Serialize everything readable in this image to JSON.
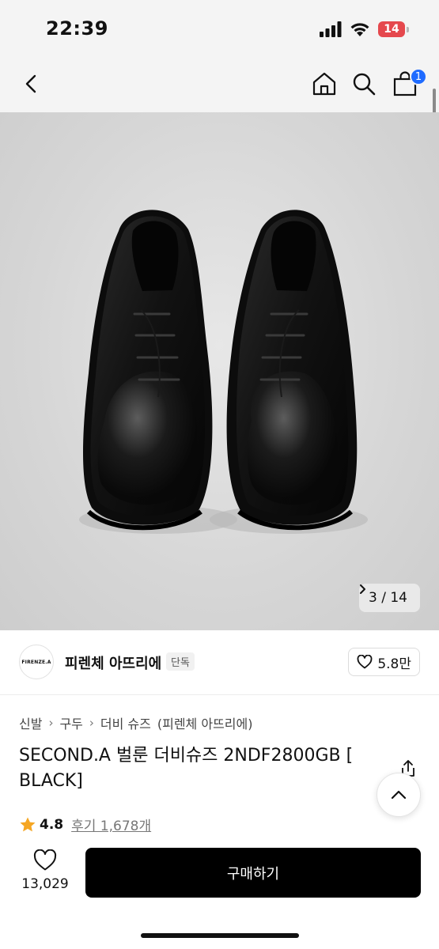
{
  "status_bar": {
    "time": "22:39",
    "battery": "14"
  },
  "nav": {
    "back_icon": "chevron-left-icon",
    "home_icon": "home-icon",
    "search_icon": "search-icon",
    "cart_icon": "shopping-bag-icon",
    "cart_badge": "1",
    "badge_color": "#1f6bff"
  },
  "gallery": {
    "counter": "3 / 14"
  },
  "brand": {
    "logo_text": "FIRENZE.A",
    "name": "피렌체 아뜨리에",
    "tag": "단독",
    "likes": "5.8만"
  },
  "breadcrumb": {
    "items": [
      "신발",
      "구두",
      "더비 슈즈"
    ],
    "extra": "(피렌체 아뜨리에)"
  },
  "product": {
    "title": "SECOND.A 벌룬 더비슈즈 2NDF2800GB [ BLACK]",
    "rating": "4.8",
    "reviews": "후기 1,678개",
    "star_color": "#f5a623"
  },
  "bottom": {
    "wish_count": "13,029",
    "buy_label": "구매하기",
    "buy_color": "#000000"
  }
}
